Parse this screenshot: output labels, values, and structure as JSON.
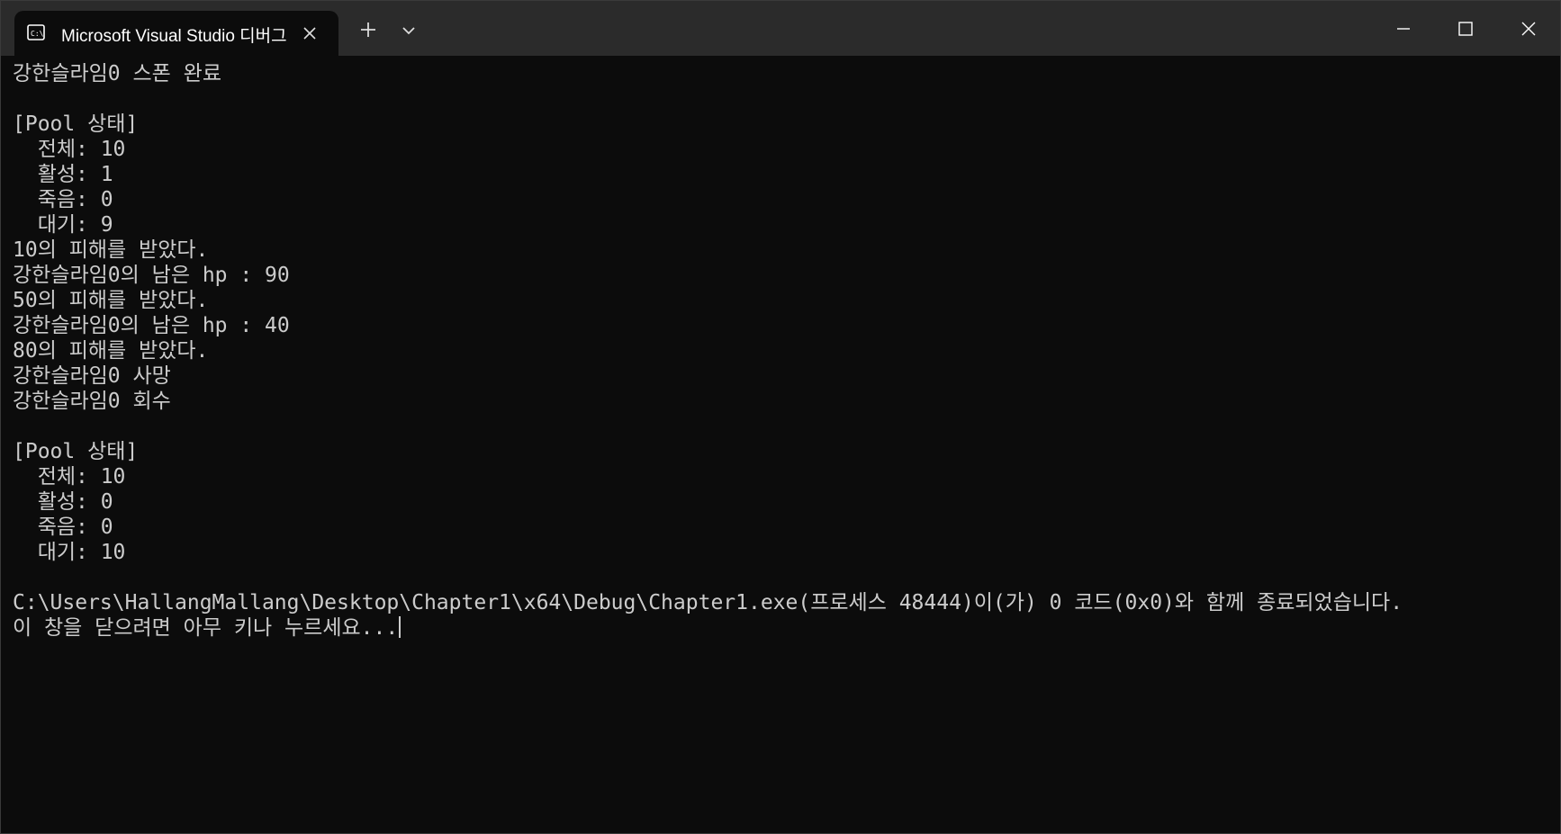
{
  "window": {
    "tab_title": "Microsoft Visual Studio 디버그",
    "tab_icon": "console-icon",
    "new_tab_icon": "plus-icon",
    "dropdown_icon": "chevron-down-icon",
    "minimize_icon": "minimize-icon",
    "maximize_icon": "maximize-icon",
    "close_icon": "close-icon"
  },
  "console": {
    "lines": [
      "강한슬라임0 스폰 완료",
      "",
      "[Pool 상태]",
      "  전체: 10",
      "  활성: 1",
      "  죽음: 0",
      "  대기: 9",
      "10의 피해를 받았다.",
      "강한슬라임0의 남은 hp : 90",
      "50의 피해를 받았다.",
      "강한슬라임0의 남은 hp : 40",
      "80의 피해를 받았다.",
      "강한슬라임0 사망",
      "강한슬라임0 회수",
      "",
      "[Pool 상태]",
      "  전체: 10",
      "  활성: 0",
      "  죽음: 0",
      "  대기: 10",
      "",
      "C:\\Users\\HallangMallang\\Desktop\\Chapter1\\x64\\Debug\\Chapter1.exe(프로세스 48444)이(가) 0 코드(0x0)와 함께 종료되었습니다.",
      "이 창을 닫으려면 아무 키나 누르세요..."
    ]
  },
  "colors": {
    "console_bg": "#0c0c0c",
    "titlebar_bg": "#2b2b2b",
    "text": "#cccccc"
  }
}
